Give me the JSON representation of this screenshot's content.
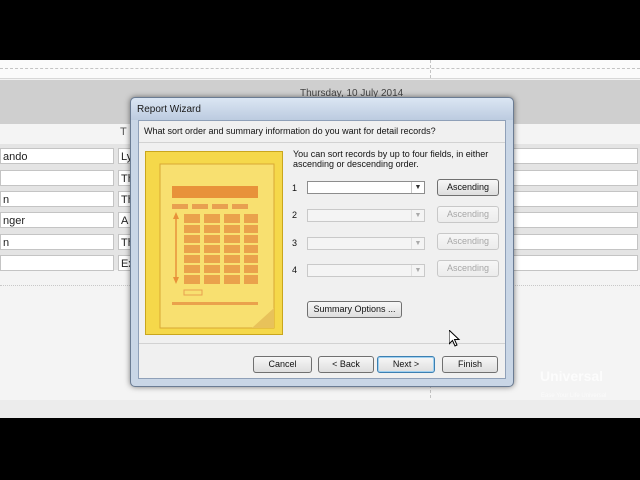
{
  "background_report": {
    "date": "Thursday, 10 July 2014",
    "left_cells": [
      "ando",
      "",
      "n",
      "nger",
      "n",
      ""
    ],
    "mid_cells": [
      "Ly",
      "Th",
      "Th",
      "A",
      "Th",
      "Ex"
    ],
    "header_partial": "T"
  },
  "dialog": {
    "title": "Report Wizard",
    "question": "What sort order and summary information do you want for detail records?",
    "info": "You can sort records by up to four fields, in either ascending or descending order.",
    "sort_rows": [
      {
        "num": "1",
        "value": "",
        "order": "Ascending",
        "enabled": true
      },
      {
        "num": "2",
        "value": "",
        "order": "Ascending",
        "enabled": false
      },
      {
        "num": "3",
        "value": "",
        "order": "Ascending",
        "enabled": false
      },
      {
        "num": "4",
        "value": "",
        "order": "Ascending",
        "enabled": false
      }
    ],
    "summary_button": "Summary Options ...",
    "buttons": {
      "cancel": "Cancel",
      "back": "< Back",
      "next": "Next >",
      "finish": "Finish"
    }
  },
  "watermark": {
    "brand": "Universal",
    "sub": "Ease Your Life Universal"
  },
  "colors": {
    "illustration": "#f2d33c",
    "illustration_accent": "#e8923a",
    "dialog_frame": "#c9d6e6"
  }
}
